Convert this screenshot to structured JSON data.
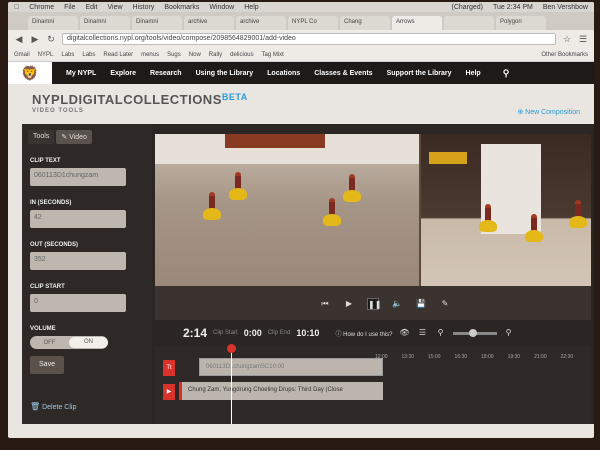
{
  "menubar": {
    "items": [
      "Chrome",
      "File",
      "Edit",
      "View",
      "History",
      "Bookmarks",
      "Window",
      "Help"
    ],
    "status_battery": "(Charged)",
    "status_clock": "Tue 2:34 PM",
    "status_user": "Ben Vershbow"
  },
  "browser_tabs": [
    "Dinamni",
    "Dinamni",
    "Dinamni",
    "archive",
    "archive",
    "NYPL Co",
    "Chang",
    "Arrows",
    "",
    "Polygon"
  ],
  "url": "digitalcollections.nypl.org/tools/video/compose/2098564829001/add-video",
  "bookmarks": {
    "items": [
      "Gmail",
      "NYPL",
      "Labs",
      "Labs",
      "Read Later",
      "menus",
      "Sugs",
      "Now",
      "Rally",
      "delicious",
      "Tag Mixt"
    ],
    "other": "Other Bookmarks"
  },
  "nypl_nav": {
    "items": [
      "My NYPL",
      "Explore",
      "Research",
      "Using the Library",
      "Locations",
      "Classes & Events",
      "Support the Library",
      "Help"
    ]
  },
  "dc": {
    "title": "NYPLDIGITALCOLLECTIONS",
    "beta": "BETA",
    "subtitle": "VIDEO TOOLS",
    "new_composition": "New Composition"
  },
  "left_panel": {
    "tabs": [
      "Tools",
      "Video"
    ],
    "clip_text_label": "CLIP TEXT",
    "clip_text_value": "060113D1chungzam",
    "in_label": "IN (SECONDS)",
    "in_value": "42",
    "out_label": "OUT (SECONDS)",
    "out_value": "352",
    "clip_start_label": "CLIP START",
    "clip_start_value": "0",
    "volume_label": "VOLUME",
    "volume_off": "OFF",
    "volume_on": "ON",
    "save_label": "Save",
    "delete_label": "Delete Clip"
  },
  "time_bar": {
    "current": "2:14",
    "clip_start_label": "Clip Start",
    "clip_start": "0:00",
    "clip_end_label": "Clip End",
    "clip_end": "10:10",
    "help": "How do I use this?"
  },
  "timeline": {
    "ticks": [
      "12:00",
      "13:30",
      "15:00",
      "16:30",
      "18:00",
      "19:30",
      "21:00",
      "22:30"
    ],
    "clip1": "060113D1chungzamSC10:00",
    "clip2": "Chung Zam, Yungdrung Choeling Drups: Third Day (Close"
  }
}
